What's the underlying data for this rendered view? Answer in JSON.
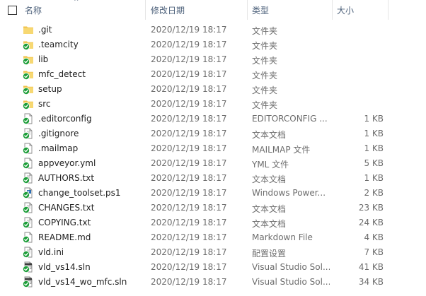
{
  "header": {
    "name": "名称",
    "modified": "修改日期",
    "type": "类型",
    "size": "大小"
  },
  "files": [
    {
      "name": ".git",
      "date": "2020/12/19 18:17",
      "type": "文件夹",
      "size": "",
      "icon": "folder-icon"
    },
    {
      "name": ".teamcity",
      "date": "2020/12/19 18:17",
      "type": "文件夹",
      "size": "",
      "icon": "folder-synced-icon"
    },
    {
      "name": "lib",
      "date": "2020/12/19 18:17",
      "type": "文件夹",
      "size": "",
      "icon": "folder-synced-icon"
    },
    {
      "name": "mfc_detect",
      "date": "2020/12/19 18:17",
      "type": "文件夹",
      "size": "",
      "icon": "folder-synced-icon"
    },
    {
      "name": "setup",
      "date": "2020/12/19 18:17",
      "type": "文件夹",
      "size": "",
      "icon": "folder-synced-icon"
    },
    {
      "name": "src",
      "date": "2020/12/19 18:17",
      "type": "文件夹",
      "size": "",
      "icon": "folder-synced-icon"
    },
    {
      "name": ".editorconfig",
      "date": "2020/12/19 18:17",
      "type": "EDITORCONFIG ...",
      "size": "1 KB",
      "icon": "file-synced-icon"
    },
    {
      "name": ".gitignore",
      "date": "2020/12/19 18:17",
      "type": "文本文档",
      "size": "1 KB",
      "icon": "text-file-synced-icon"
    },
    {
      "name": ".mailmap",
      "date": "2020/12/19 18:17",
      "type": "MAILMAP 文件",
      "size": "1 KB",
      "icon": "file-synced-icon"
    },
    {
      "name": "appveyor.yml",
      "date": "2020/12/19 18:17",
      "type": "YML 文件",
      "size": "5 KB",
      "icon": "file-synced-icon"
    },
    {
      "name": "AUTHORS.txt",
      "date": "2020/12/19 18:17",
      "type": "文本文档",
      "size": "1 KB",
      "icon": "text-file-synced-icon"
    },
    {
      "name": "change_toolset.ps1",
      "date": "2020/12/19 18:17",
      "type": "Windows Power...",
      "size": "2 KB",
      "icon": "powershell-file-synced-icon"
    },
    {
      "name": "CHANGES.txt",
      "date": "2020/12/19 18:17",
      "type": "文本文档",
      "size": "23 KB",
      "icon": "text-file-synced-icon"
    },
    {
      "name": "COPYING.txt",
      "date": "2020/12/19 18:17",
      "type": "文本文档",
      "size": "24 KB",
      "icon": "text-file-synced-icon"
    },
    {
      "name": "README.md",
      "date": "2020/12/19 18:17",
      "type": "Markdown File",
      "size": "4 KB",
      "icon": "file-synced-icon"
    },
    {
      "name": "vld.ini",
      "date": "2020/12/19 18:17",
      "type": "配置设置",
      "size": "7 KB",
      "icon": "settings-file-synced-icon"
    },
    {
      "name": "vld_vs14.sln",
      "date": "2020/12/19 18:17",
      "type": "Visual Studio Sol...",
      "size": "41 KB",
      "icon": "solution-file-synced-icon"
    },
    {
      "name": "vld_vs14_wo_mfc.sln",
      "date": "2020/12/19 18:17",
      "type": "Visual Studio Sol...",
      "size": "34 KB",
      "icon": "solution-file-synced-icon"
    }
  ],
  "colors": {
    "folder": "#f5cf6b",
    "sync_green": "#1e9e3a",
    "header_text": "#4c607a",
    "meta_text": "#6d6d6d"
  }
}
